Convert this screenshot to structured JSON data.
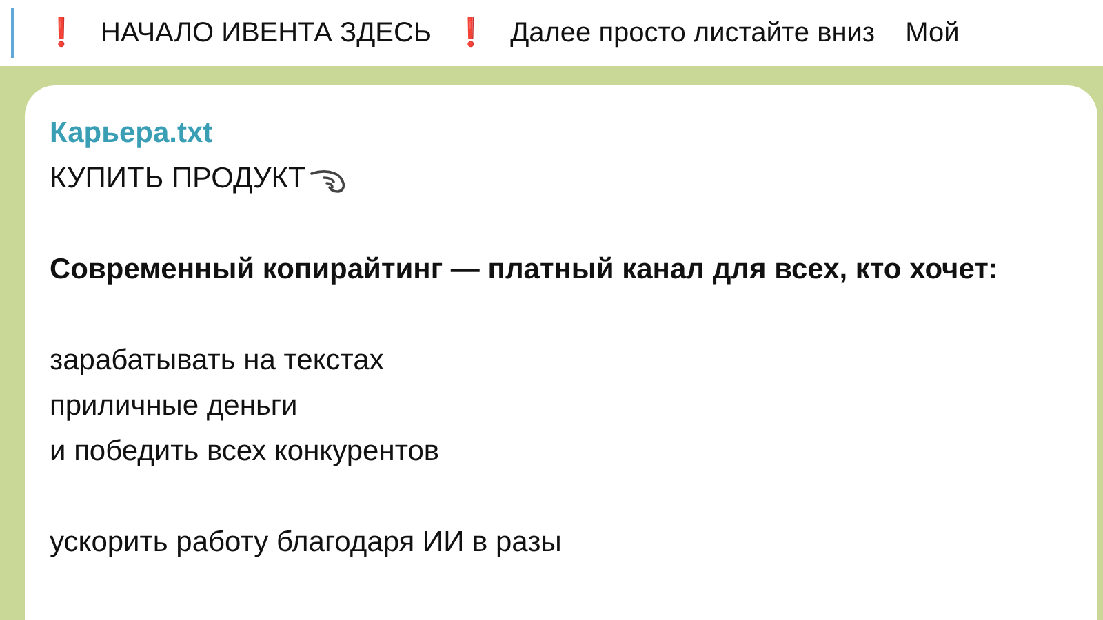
{
  "pinned": {
    "segments": [
      {
        "kind": "mark",
        "text": "❗"
      },
      {
        "kind": "text",
        "text": "НАЧАЛО ИВЕНТА ЗДЕСЬ"
      },
      {
        "kind": "mark",
        "text": "❗"
      },
      {
        "kind": "text",
        "text": "Далее просто листайте вниз"
      },
      {
        "kind": "text",
        "text": "Мой"
      }
    ]
  },
  "message": {
    "sender": "Карьера.txt",
    "blocks": [
      {
        "kind": "cta",
        "lines": [
          "КУПИТЬ ПРОДУКТ"
        ]
      },
      {
        "kind": "heading",
        "lines": [
          "Современный копирайтинг — платный канал для всех, кто хочет:"
        ]
      },
      {
        "kind": "plain",
        "lines": [
          "зарабатывать на текстах",
          "приличные деньги",
          "и победить всех конкурентов"
        ]
      },
      {
        "kind": "plain",
        "lines": [
          "ускорить работу благодаря ИИ в разы"
        ]
      }
    ]
  }
}
